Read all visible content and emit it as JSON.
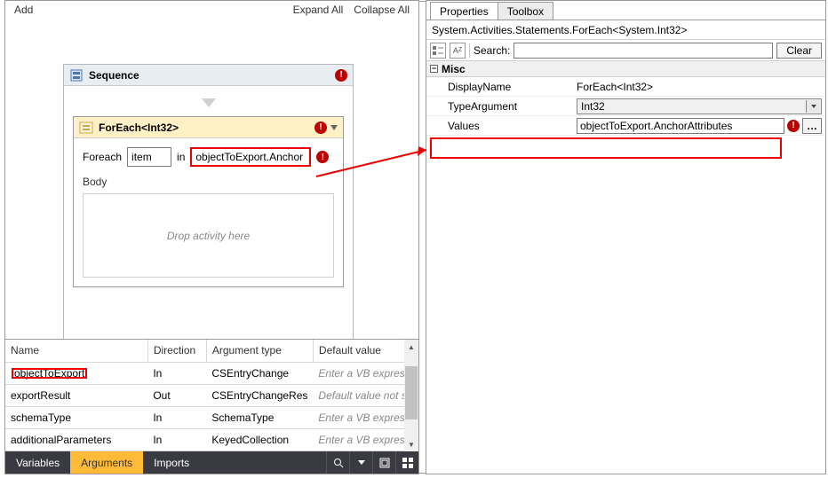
{
  "toolbar": {
    "add": "Add",
    "expand": "Expand All",
    "collapse": "Collapse All"
  },
  "designer": {
    "sequence_title": "Sequence",
    "foreach_title": "ForEach<Int32>",
    "foreach_kw": "Foreach",
    "in_kw": "in",
    "item_var": "item",
    "collection_expr": "objectToExport.Anchor",
    "body_label": "Body",
    "drop_hint": "Drop activity here"
  },
  "args": {
    "headers": {
      "name": "Name",
      "direction": "Direction",
      "type": "Argument type",
      "default": "Default value"
    },
    "rows": [
      {
        "name": "objectToExport",
        "dir": "In",
        "type": "CSEntryChange",
        "def": "Enter a VB express",
        "def_ph": true,
        "hl": true
      },
      {
        "name": "exportResult",
        "dir": "Out",
        "type": "CSEntryChangeRes",
        "def": "Default value not su",
        "def_ph": true,
        "hl": false
      },
      {
        "name": "schemaType",
        "dir": "In",
        "type": "SchemaType",
        "def": "Enter a VB express",
        "def_ph": true,
        "hl": false
      },
      {
        "name": "additionalParameters",
        "dir": "In",
        "type": "KeyedCollection<S",
        "def": "Enter a VB express",
        "def_ph": true,
        "hl": false
      }
    ]
  },
  "bottom": {
    "variables": "Variables",
    "arguments": "Arguments",
    "imports": "Imports"
  },
  "props": {
    "tab_properties": "Properties",
    "tab_toolbox": "Toolbox",
    "type_line": "System.Activities.Statements.ForEach<System.Int32>",
    "search_label": "Search:",
    "clear": "Clear",
    "misc": "Misc",
    "rows": {
      "displayName": {
        "label": "DisplayName",
        "value": "ForEach<Int32>"
      },
      "typeArgument": {
        "label": "TypeArgument",
        "value": "Int32"
      },
      "values": {
        "label": "Values",
        "value": "objectToExport.AnchorAttributes"
      }
    }
  }
}
